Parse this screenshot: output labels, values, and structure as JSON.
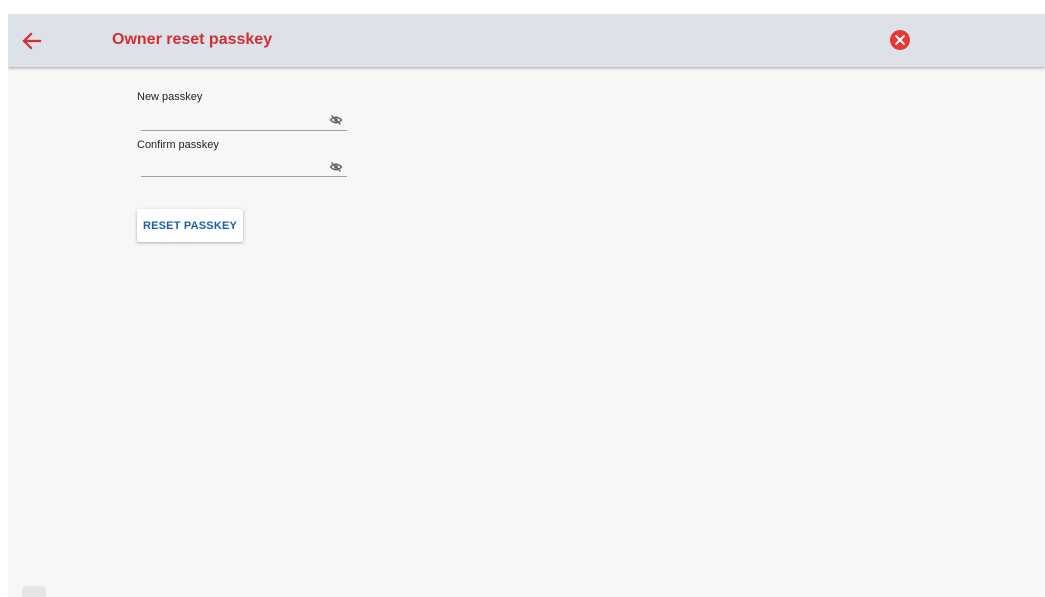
{
  "appbar": {
    "title": "Owner reset passkey",
    "back_icon": "arrow-left-icon",
    "close_icon": "close-circle-icon"
  },
  "form": {
    "new_passkey": {
      "label": "New passkey",
      "value": "",
      "placeholder": "",
      "icon": "eye-off-icon"
    },
    "confirm_passkey": {
      "label": "Confirm passkey",
      "value": "",
      "placeholder": "",
      "icon": "eye-off-icon"
    },
    "reset_button_label": "RESET PASSKEY"
  },
  "colors": {
    "accent": "#d32f2f",
    "appbar_bg": "#dce1ea",
    "button_text": "#1e5fa8",
    "background": "#f7f7f7"
  }
}
